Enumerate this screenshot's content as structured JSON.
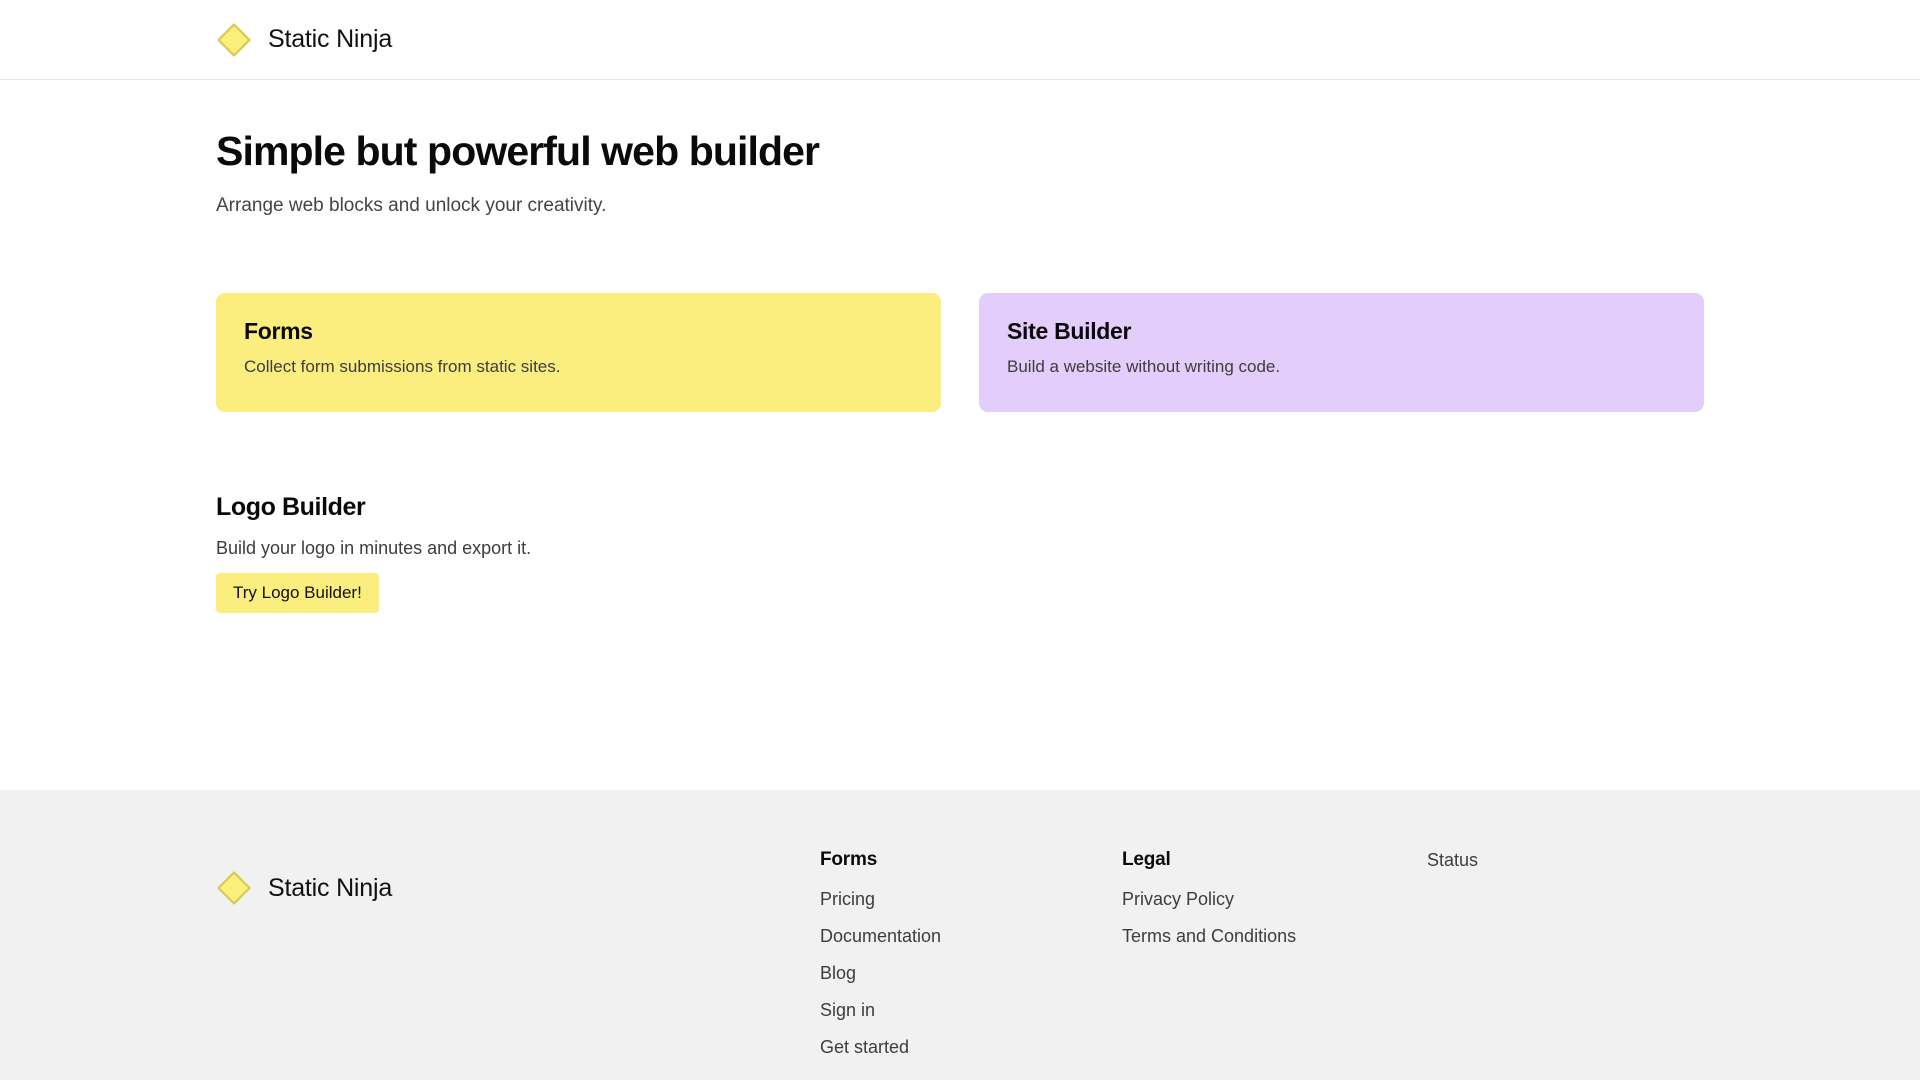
{
  "header": {
    "logo_icon": "diamond-logo-icon",
    "brand_name": "Static Ninja"
  },
  "hero": {
    "title": "Simple but powerful web builder",
    "subtitle": "Arrange web blocks and unlock your creativity."
  },
  "cards": [
    {
      "title": "Forms",
      "description": "Collect form submissions from static sites.",
      "color": "#fbed7e"
    },
    {
      "title": "Site Builder",
      "description": "Build a website without writing code.",
      "color": "#e2cdfb"
    }
  ],
  "promo": {
    "title": "Logo Builder",
    "description": "Build your logo in minutes and export it.",
    "button_label": "Try Logo Builder!",
    "button_color": "#fbed7e"
  },
  "footer": {
    "logo_icon": "diamond-logo-icon",
    "brand_name": "Static Ninja",
    "columns": [
      {
        "heading": "Forms",
        "links": [
          "Pricing",
          "Documentation",
          "Blog",
          "Sign in",
          "Get started"
        ]
      },
      {
        "heading": "Legal",
        "links": [
          "Privacy Policy",
          "Terms and Conditions"
        ]
      }
    ],
    "misc_links": [
      "Status"
    ],
    "background": "#f1f1f1"
  },
  "theme": {
    "accent_yellow": "#fbed7e",
    "accent_purple": "#e2cdfb",
    "logo_fill": "#faf07a",
    "logo_stroke": "#d9cf4a",
    "text_primary": "#0a0a0a",
    "text_secondary": "#3d3d3d",
    "border": "#e6e6e6"
  }
}
